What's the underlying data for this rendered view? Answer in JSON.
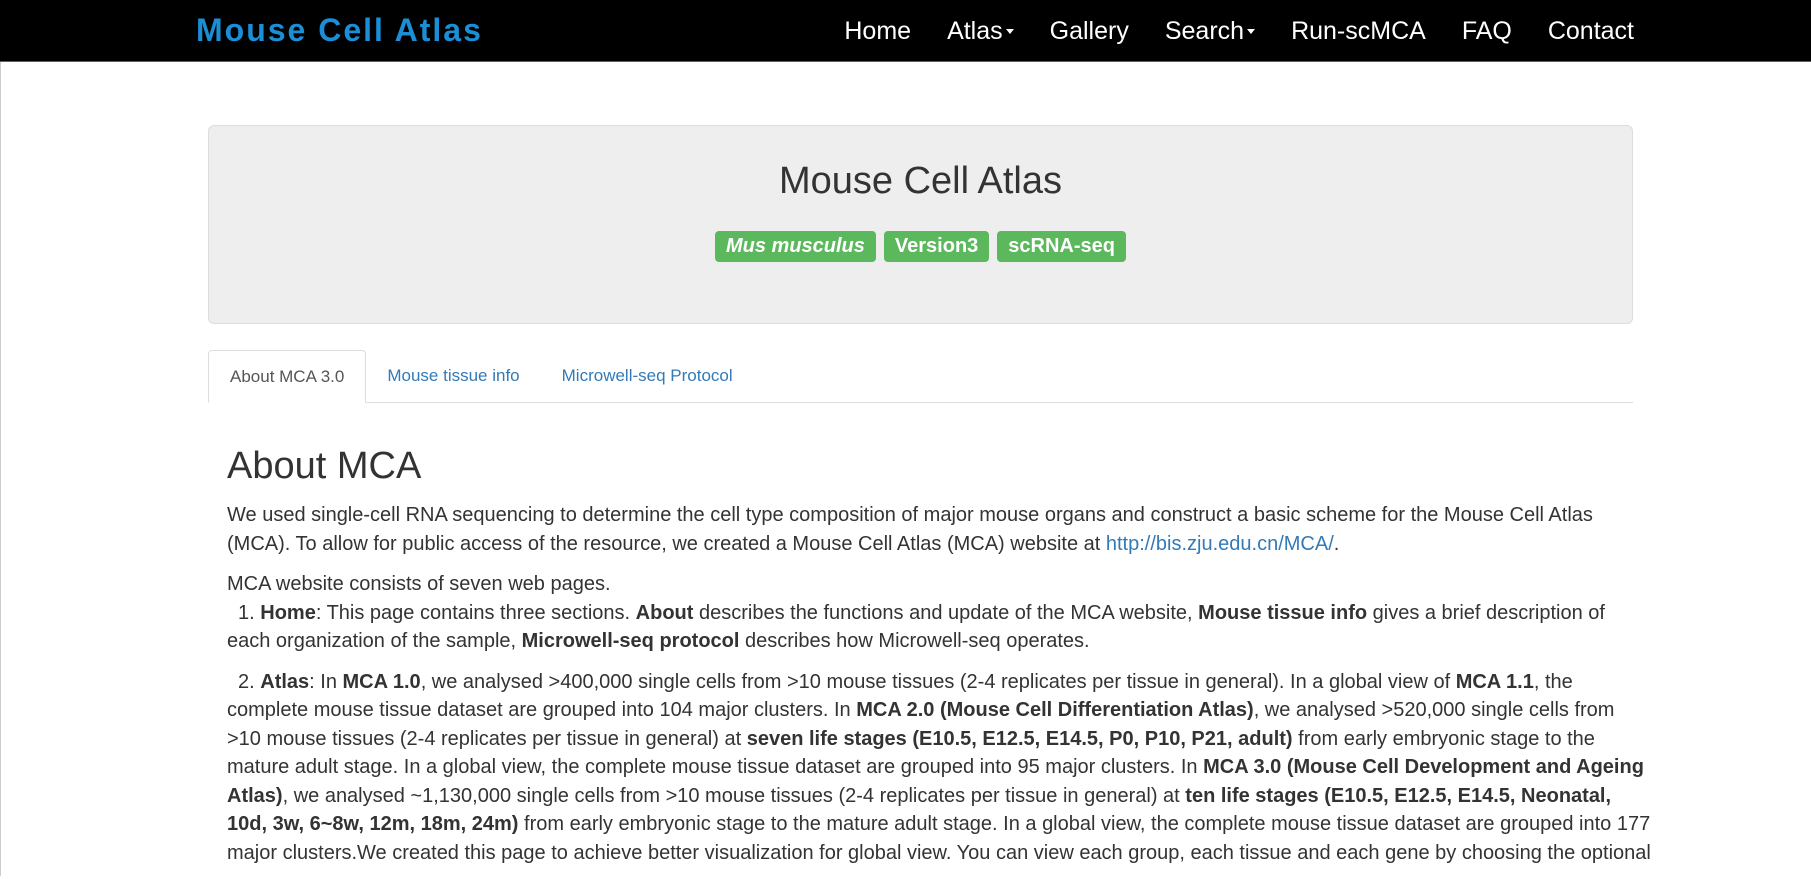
{
  "navbar": {
    "brand": "Mouse Cell Atlas",
    "items": [
      {
        "label": "Home",
        "dropdown": false
      },
      {
        "label": "Atlas",
        "dropdown": true
      },
      {
        "label": "Gallery",
        "dropdown": false
      },
      {
        "label": "Search",
        "dropdown": true
      },
      {
        "label": "Run-scMCA",
        "dropdown": false
      },
      {
        "label": "FAQ",
        "dropdown": false
      },
      {
        "label": "Contact",
        "dropdown": false
      }
    ]
  },
  "jumbotron": {
    "title": "Mouse Cell Atlas",
    "badges": [
      "Mus musculus",
      "Version3",
      "scRNA-seq"
    ]
  },
  "tabs": [
    {
      "label": "About MCA 3.0",
      "active": true
    },
    {
      "label": "Mouse tissue info",
      "active": false
    },
    {
      "label": "Microwell-seq Protocol",
      "active": false
    }
  ],
  "about": {
    "heading": "About MCA",
    "intro": {
      "text": "We used single-cell RNA sequencing to determine the cell type composition of major mouse organs and construct a basic scheme for the Mouse Cell Atlas (MCA). To allow for public access of the resource, we created a Mouse Cell Atlas (MCA) website at ",
      "link": "http://bis.zju.edu.cn/MCA/",
      "end": "."
    },
    "pages_intro": "MCA website consists of seven web pages.",
    "item1": {
      "num": "1.",
      "t1": "Home",
      "t2": ": This page contains three sections. ",
      "t3": "About",
      "t4": " describes the functions and update of the MCA website, ",
      "t5": "Mouse tissue info",
      "t6": " gives a brief description of each organization of the sample, ",
      "t7": "Microwell-seq protocol",
      "t8": " describes how Microwell-seq operates."
    },
    "item2": {
      "num": "2.",
      "t1": "Atlas",
      "t2": ": In ",
      "t3": "MCA 1.0",
      "t4": ", we analysed >400,000 single cells from >10 mouse tissues (2-4 replicates per tissue in general). In a global view of ",
      "t5": "MCA 1.1",
      "t6": ", the complete mouse tissue dataset are grouped into 104 major clusters. In ",
      "t7": "MCA 2.0 (Mouse Cell Differentiation Atlas)",
      "t8": ", we analysed >520,000 single cells from >10 mouse tissues (2-4 replicates per tissue in general) at ",
      "t9": "seven life stages (E10.5, E12.5, E14.5, P0, P10, P21, adult)",
      "t10": " from early embryonic stage to the mature adult stage. In a global view, the complete mouse tissue dataset are grouped into 95 major clusters. In ",
      "t11": "MCA 3.0 (Mouse Cell Development and Ageing Atlas)",
      "t12": ", we analysed ~1,130,000 single cells from >10 mouse tissues (2-4 replicates per tissue in general) at ",
      "t13": "ten life stages (E10.5, E12.5, E14.5, Neonatal, 10d, 3w, 6~8w, 12m, 18m, 24m)",
      "t14": " from early embryonic stage to the mature adult stage. In a global view, the complete mouse tissue dataset are grouped into 177 major clusters.We created this page to achieve better visualization for global view. You can view each group, each tissue and each gene by choosing the optional"
    }
  }
}
